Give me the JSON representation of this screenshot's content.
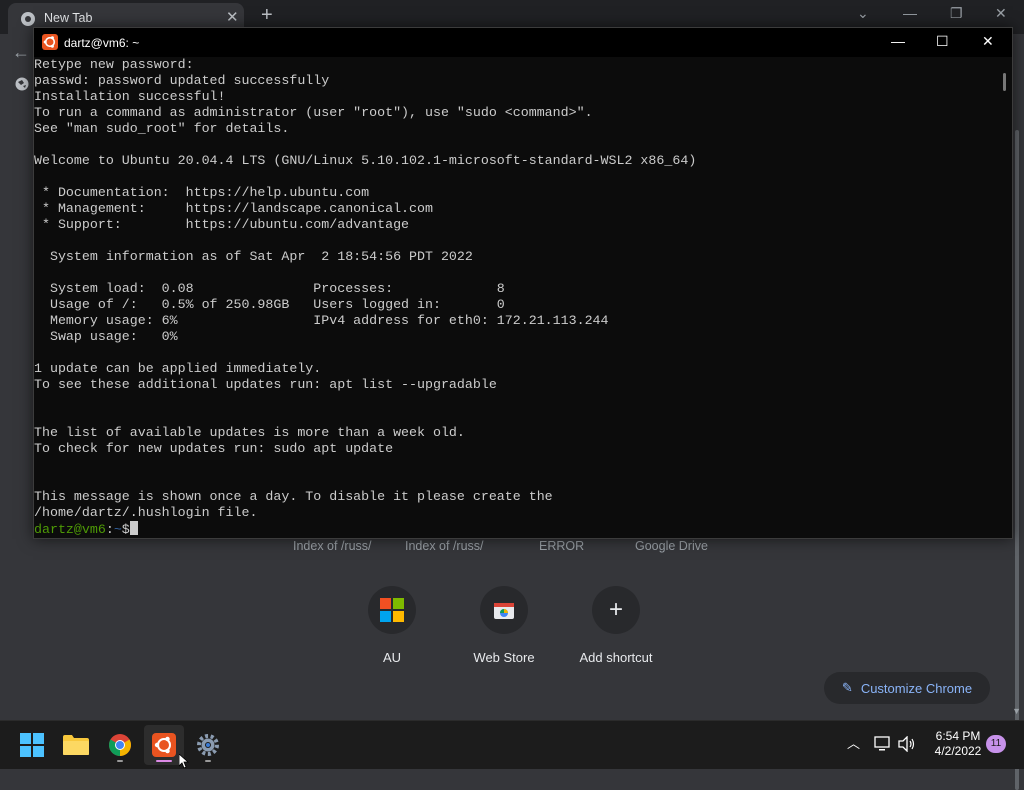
{
  "chrome": {
    "tab_title": "New Tab",
    "shortcut_titles": [
      "Index of /russ/",
      "Index of /russ/",
      "ERROR",
      "Google Drive"
    ],
    "tiles": [
      {
        "label": "AU",
        "icon": "microsoft-logo-icon"
      },
      {
        "label": "Web Store",
        "icon": "web-store-icon"
      },
      {
        "label": "Add shortcut",
        "icon": "plus-icon"
      }
    ],
    "customize_label": "Customize Chrome"
  },
  "terminal": {
    "title": "dartz@vm6: ~",
    "lines": [
      "Retype new password:",
      "passwd: password updated successfully",
      "Installation successful!",
      "To run a command as administrator (user \"root\"), use \"sudo <command>\".",
      "See \"man sudo_root\" for details.",
      "",
      "Welcome to Ubuntu 20.04.4 LTS (GNU/Linux 5.10.102.1-microsoft-standard-WSL2 x86_64)",
      "",
      " * Documentation:  https://help.ubuntu.com",
      " * Management:     https://landscape.canonical.com",
      " * Support:        https://ubuntu.com/advantage",
      "",
      "  System information as of Sat Apr  2 18:54:56 PDT 2022",
      "",
      "  System load:  0.08               Processes:             8",
      "  Usage of /:   0.5% of 250.98GB   Users logged in:       0",
      "  Memory usage: 6%                 IPv4 address for eth0: 172.21.113.244",
      "  Swap usage:   0%",
      "",
      "1 update can be applied immediately.",
      "To see these additional updates run: apt list --upgradable",
      "",
      "",
      "The list of available updates is more than a week old.",
      "To check for new updates run: sudo apt update",
      "",
      "",
      "This message is shown once a day. To disable it please create the",
      "/home/dartz/.hushlogin file."
    ],
    "prompt_user": "dartz@vm6",
    "prompt_sep": ":",
    "prompt_path": "~",
    "prompt_symbol": "$"
  },
  "taskbar": {
    "apps": [
      "start-icon",
      "file-explorer-icon",
      "chrome-icon",
      "ubuntu-icon",
      "settings-icon"
    ],
    "time": "6:54 PM",
    "date": "4/2/2022",
    "notification_count": "11"
  }
}
